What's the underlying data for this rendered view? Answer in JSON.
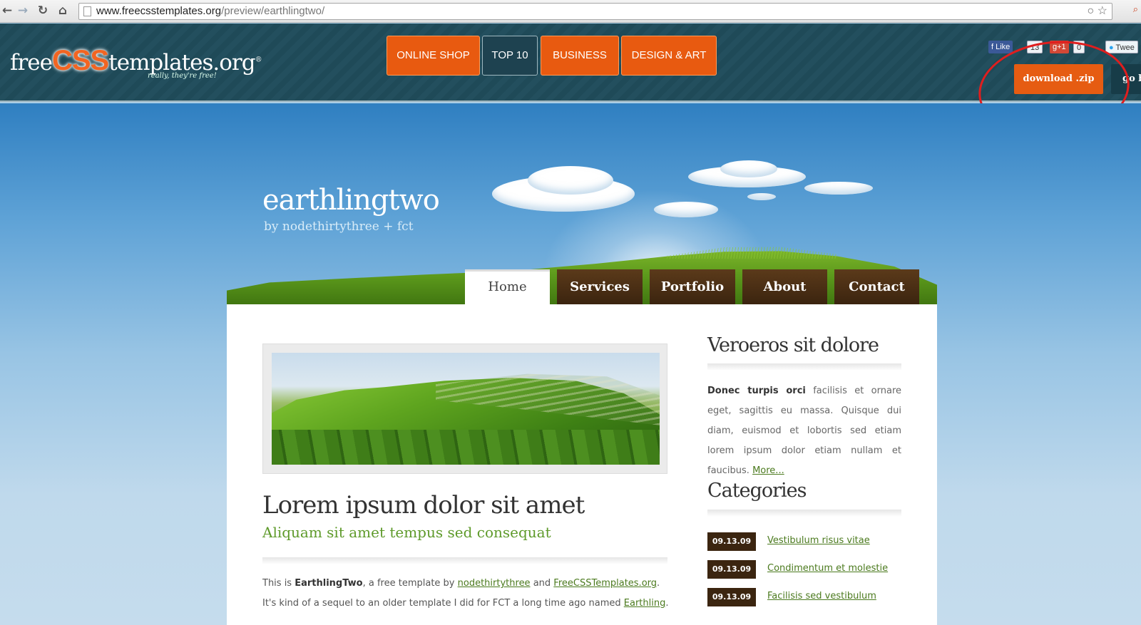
{
  "browser": {
    "url_host": "www.freecsstemplates.org",
    "url_path": "/preview/earthlingtwo/",
    "back_icon": "back-arrow-icon",
    "forward_icon": "forward-arrow-icon",
    "reload_icon": "reload-icon",
    "home_icon": "home-icon"
  },
  "topbar": {
    "logo_pre": "free",
    "logo_css": "CSS",
    "logo_post": "templates.org",
    "logo_reg": "®",
    "tagline": "really, they're free!",
    "nav": [
      {
        "label": "ONLINE SHOP"
      },
      {
        "label": "TOP 10"
      },
      {
        "label": "BUSINESS"
      },
      {
        "label": "DESIGN & ART"
      }
    ],
    "social": {
      "like": "Like",
      "like_count": "13",
      "gplus": "g+1",
      "gplus_count": "0",
      "tweet": "Twee"
    },
    "download_label": "download .zip",
    "go_label": "go b"
  },
  "hero": {
    "title": "earthlingtwo",
    "subtitle": "by nodethirtythree + fct"
  },
  "site_nav": [
    {
      "label": "Home"
    },
    {
      "label": "Services"
    },
    {
      "label": "Portfolio"
    },
    {
      "label": "About"
    },
    {
      "label": "Contact"
    }
  ],
  "post": {
    "title": "Lorem ipsum dolor sit amet",
    "subtitle": "Aliquam sit amet tempus sed consequat",
    "body_1": "This is ",
    "body_bold": "EarthlingTwo",
    "body_2": ", a free template by ",
    "link_1": "nodethirtythree",
    "body_3": " and ",
    "link_2": "FreeCSSTemplates.org",
    "body_4": ". It's kind of a sequel to an older template I did for FCT a long time ago named ",
    "link_3": "Earthling",
    "body_5": "."
  },
  "sidebar": {
    "title1": "Veroeros sit dolore",
    "text_bold": "Donec turpis orci",
    "text": " facilisis et ornare eget, sagittis eu massa. Quisque dui diam, euismod et lobortis sed etiam lorem ipsum dolor etiam nullam et faucibus. ",
    "more": "More...",
    "title2": "Categories",
    "categories": [
      {
        "date": "09.13.09",
        "label": "Vestibulum risus vitae"
      },
      {
        "date": "09.13.09",
        "label": "Condimentum et molestie"
      },
      {
        "date": "09.13.09",
        "label": "Facilisis sed vestibulum"
      }
    ]
  },
  "colors": {
    "accent_orange": "#e85a10",
    "header_teal": "#1f4a58",
    "nav_brown": "#3b240f",
    "link_green": "#4b7a1e",
    "annotation_red": "#e01e1e"
  }
}
